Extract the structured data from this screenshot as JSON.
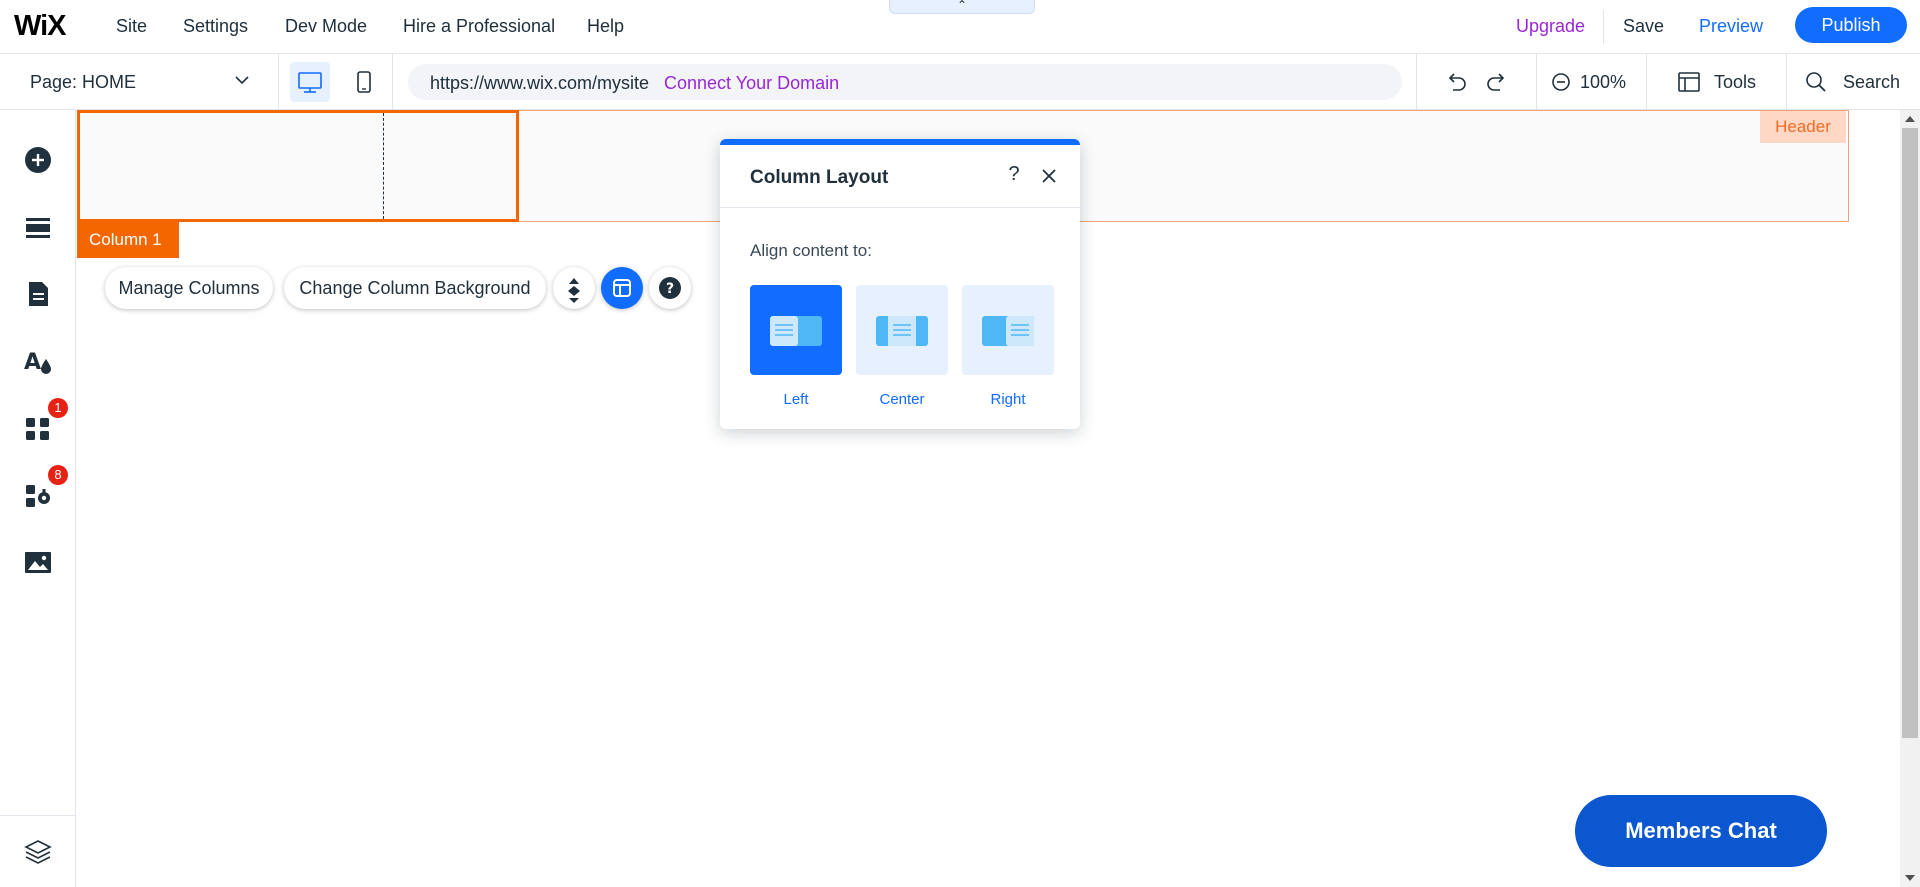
{
  "topbar": {
    "logo": "WiX",
    "menu": [
      "Site",
      "Settings",
      "Dev Mode",
      "Hire a Professional",
      "Help"
    ],
    "collapse_glyph": "⌃",
    "upgrade": "Upgrade",
    "save": "Save",
    "preview": "Preview",
    "publish": "Publish"
  },
  "toolbar": {
    "page_prefix": "Page: ",
    "page_name": "HOME",
    "url": "https://www.wix.com/mysite",
    "connect_domain": "Connect Your Domain",
    "zoom": "100%",
    "tools": "Tools",
    "search": "Search"
  },
  "sidebar": {
    "items": [
      {
        "icon": "add-icon"
      },
      {
        "icon": "sections-icon"
      },
      {
        "icon": "pages-icon"
      },
      {
        "icon": "design-icon"
      },
      {
        "icon": "apps-icon",
        "badge": "1"
      },
      {
        "icon": "business-tools-icon",
        "badge": "8"
      },
      {
        "icon": "media-icon"
      },
      {
        "icon": "layers-icon"
      }
    ]
  },
  "canvas": {
    "header_tag": "Header",
    "column_tag": "Column 1",
    "manage_columns": "Manage Columns",
    "change_background": "Change Column Background",
    "members_chat": "Members Chat"
  },
  "panel": {
    "title": "Column Layout",
    "help": "?",
    "subtitle": "Align content to:",
    "options": [
      {
        "label": "Left",
        "selected": true
      },
      {
        "label": "Center",
        "selected": false
      },
      {
        "label": "Right",
        "selected": false
      }
    ]
  },
  "colors": {
    "accent": "#116dff",
    "selection": "#f46700",
    "upgrade": "#9a27d5",
    "members_chat": "#0a57d0"
  }
}
